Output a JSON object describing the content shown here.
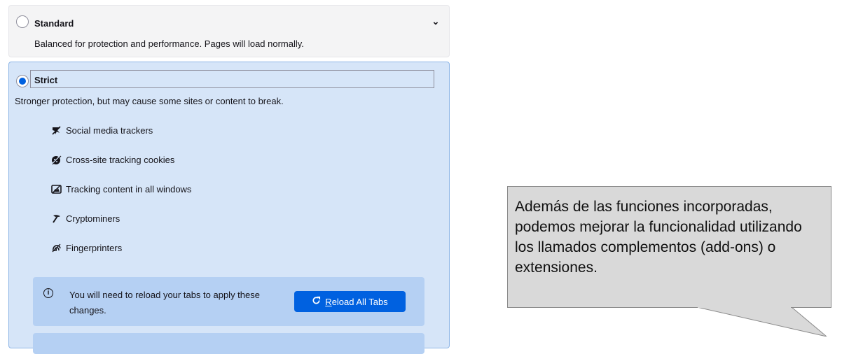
{
  "standard": {
    "title": "Standard",
    "description": "Balanced for protection and performance. Pages will load normally.",
    "selected": false,
    "expand_icon": "chevron-down-icon"
  },
  "strict": {
    "title": "Strict",
    "description": "Stronger protection, but may cause some sites or content to break.",
    "selected": true,
    "features": [
      {
        "icon": "social-tracker-icon",
        "label": "Social media trackers"
      },
      {
        "icon": "cookie-icon",
        "label": "Cross-site tracking cookies"
      },
      {
        "icon": "tracking-content-icon",
        "label": "Tracking content in all windows"
      },
      {
        "icon": "cryptominer-icon",
        "label": "Cryptominers"
      },
      {
        "icon": "fingerprinter-icon",
        "label": "Fingerprinters"
      }
    ],
    "notice": {
      "text": "You will need to reload your tabs to apply these changes.",
      "icon": "info-icon",
      "button_label_first": "R",
      "button_label_rest": "eload All Tabs",
      "button_icon": "reload-icon"
    }
  },
  "callout": {
    "text": "Además de las funciones incorporadas, podemos mejorar la funcionalidad utilizando los llamados complementos (add-ons) o extensiones."
  },
  "colors": {
    "accent": "#0061e0",
    "strict_bg": "#d6e5f8",
    "notice_bg": "#b5d0f3",
    "callout_bg": "#d9d9d9"
  }
}
